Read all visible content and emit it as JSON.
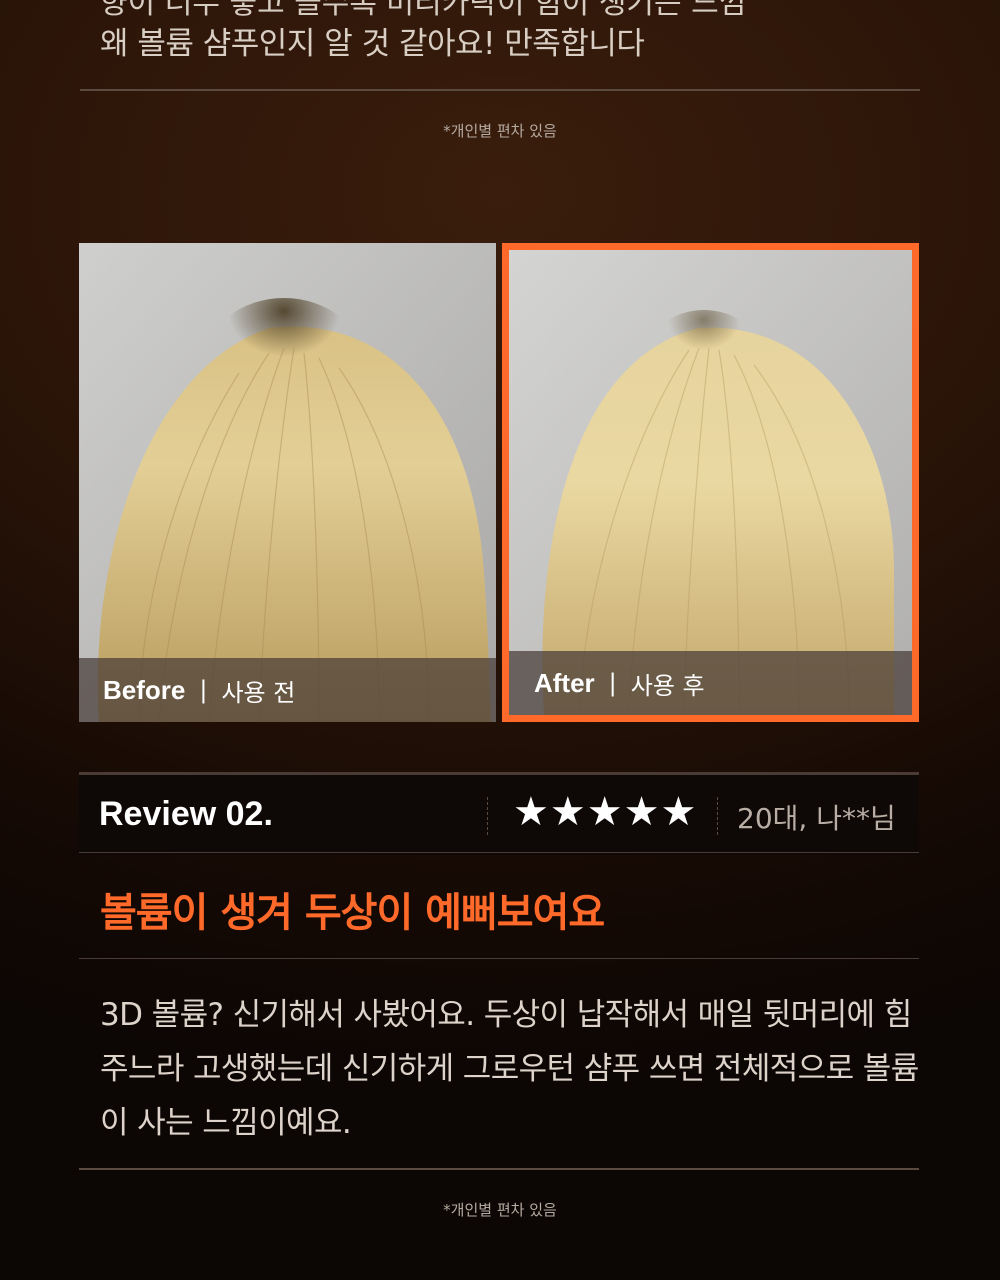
{
  "review1": {
    "line_top_partial": "향이 너무 좋고 쓸수록 머리카락이 힘이 생기는 느낌",
    "line_last": "왜 볼륨 샴푸인지 알 것 같아요! 만족합니다",
    "note": "*개인별 편차 있음"
  },
  "comparison": {
    "before": {
      "label_en": "Before",
      "separator": "|",
      "label_ko": "사용 전"
    },
    "after": {
      "label_en": "After",
      "separator": "|",
      "label_ko": "사용 후"
    },
    "highlight_color": "#ff6a2a"
  },
  "review2": {
    "title": "Review 02.",
    "stars": "★★★★★",
    "rating": 5,
    "reviewer": "20대, 나**님",
    "headline": "볼륨이 생겨 두상이 예뻐보여요",
    "body": "3D 볼륨? 신기해서 사봤어요. 두상이 납작해서 매일 뒷머리에 힘주느라 고생했는데 신기하게 그로우턴 샴푸 쓰면 전체적으로 볼륨이 사는 느낌이예요.",
    "note": "*개인별 편차 있음"
  }
}
